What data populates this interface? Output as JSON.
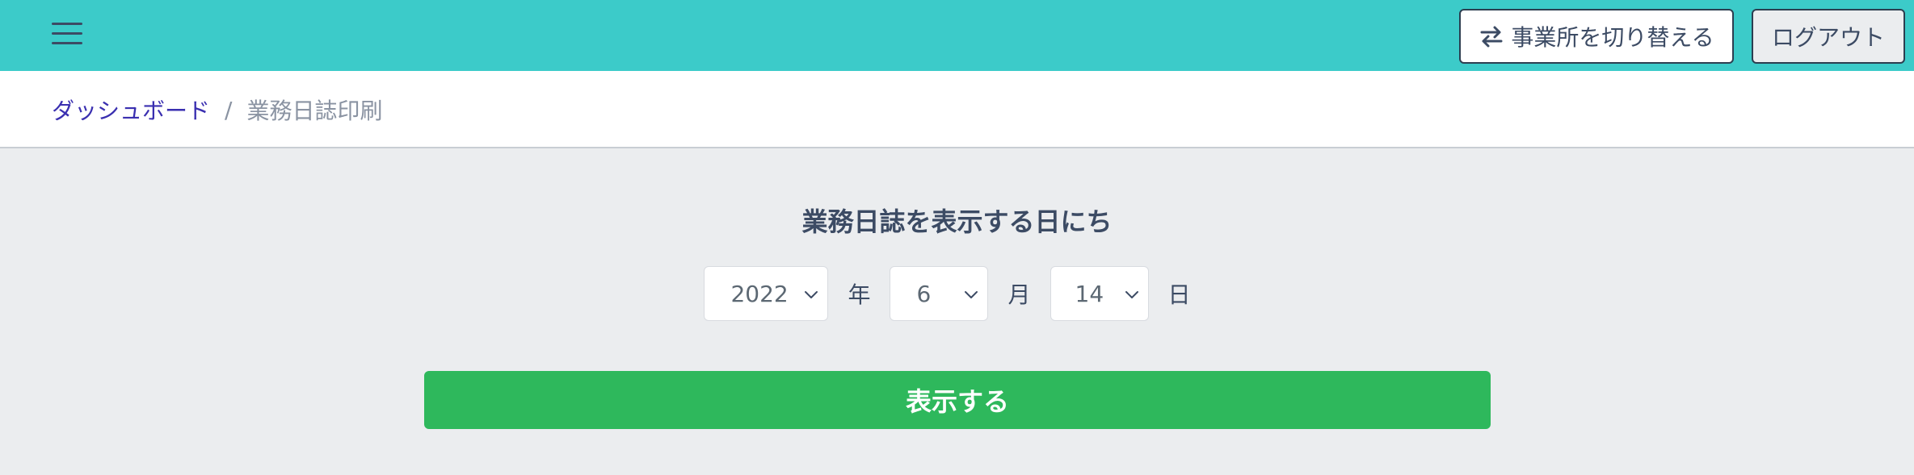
{
  "header": {
    "switch_office_label": "事業所を切り替える",
    "logout_label": "ログアウト",
    "background_color": "#3ccbc9"
  },
  "breadcrumb": {
    "items": [
      {
        "label": "ダッシュボード"
      },
      {
        "label": "業務日誌印刷"
      }
    ],
    "separator": "/"
  },
  "form": {
    "title": "業務日誌を表示する日にち",
    "year": {
      "value": "2022",
      "unit": "年"
    },
    "month": {
      "value": "6",
      "unit": "月"
    },
    "day": {
      "value": "14",
      "unit": "日"
    },
    "submit_label": "表示する",
    "submit_color": "#2eb85c"
  },
  "icons": {
    "menu": "hamburger-menu-icon",
    "switch": "swap-arrows-icon",
    "dropdown": "chevron-down-icon"
  }
}
